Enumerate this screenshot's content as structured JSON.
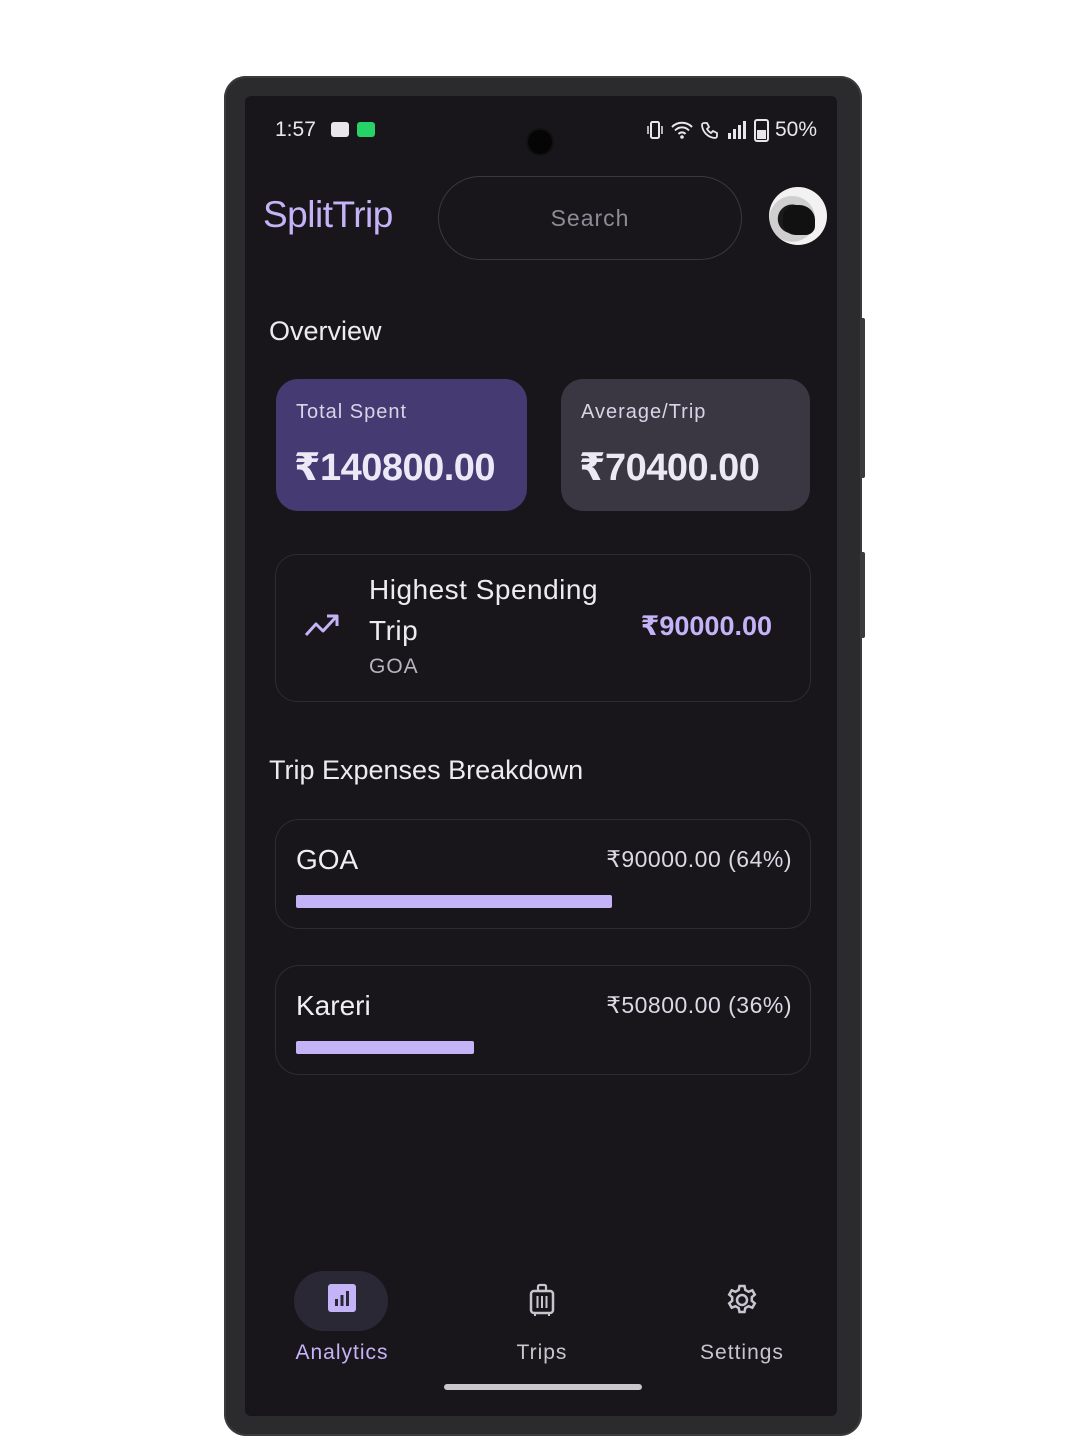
{
  "status_bar": {
    "time": "1:57",
    "battery": "50%"
  },
  "header": {
    "app_title": "SplitTrip",
    "search_placeholder": "Search"
  },
  "overview": {
    "title": "Overview",
    "total_spent": {
      "label": "Total Spent",
      "value": "₹140800.00"
    },
    "average_trip": {
      "label": "Average/Trip",
      "value": "₹70400.00"
    },
    "highest": {
      "title": "Highest Spending Trip",
      "trip": "GOA",
      "value": "₹90000.00"
    }
  },
  "breakdown": {
    "title": "Trip Expenses Breakdown",
    "items": [
      {
        "name": "GOA",
        "value": "₹90000.00 (64%)",
        "fraction": 0.64
      },
      {
        "name": "Kareri",
        "value": "₹50800.00 (36%)",
        "fraction": 0.36
      }
    ]
  },
  "nav": {
    "items": [
      {
        "label": "Analytics",
        "icon": "analytics-icon",
        "active": true
      },
      {
        "label": "Trips",
        "icon": "luggage-icon",
        "active": false
      },
      {
        "label": "Settings",
        "icon": "gear-icon",
        "active": false
      }
    ]
  },
  "colors": {
    "accent": "#c4b3f7",
    "background": "#18161b",
    "total_card": "#453a72",
    "average_card": "#3b3742"
  }
}
